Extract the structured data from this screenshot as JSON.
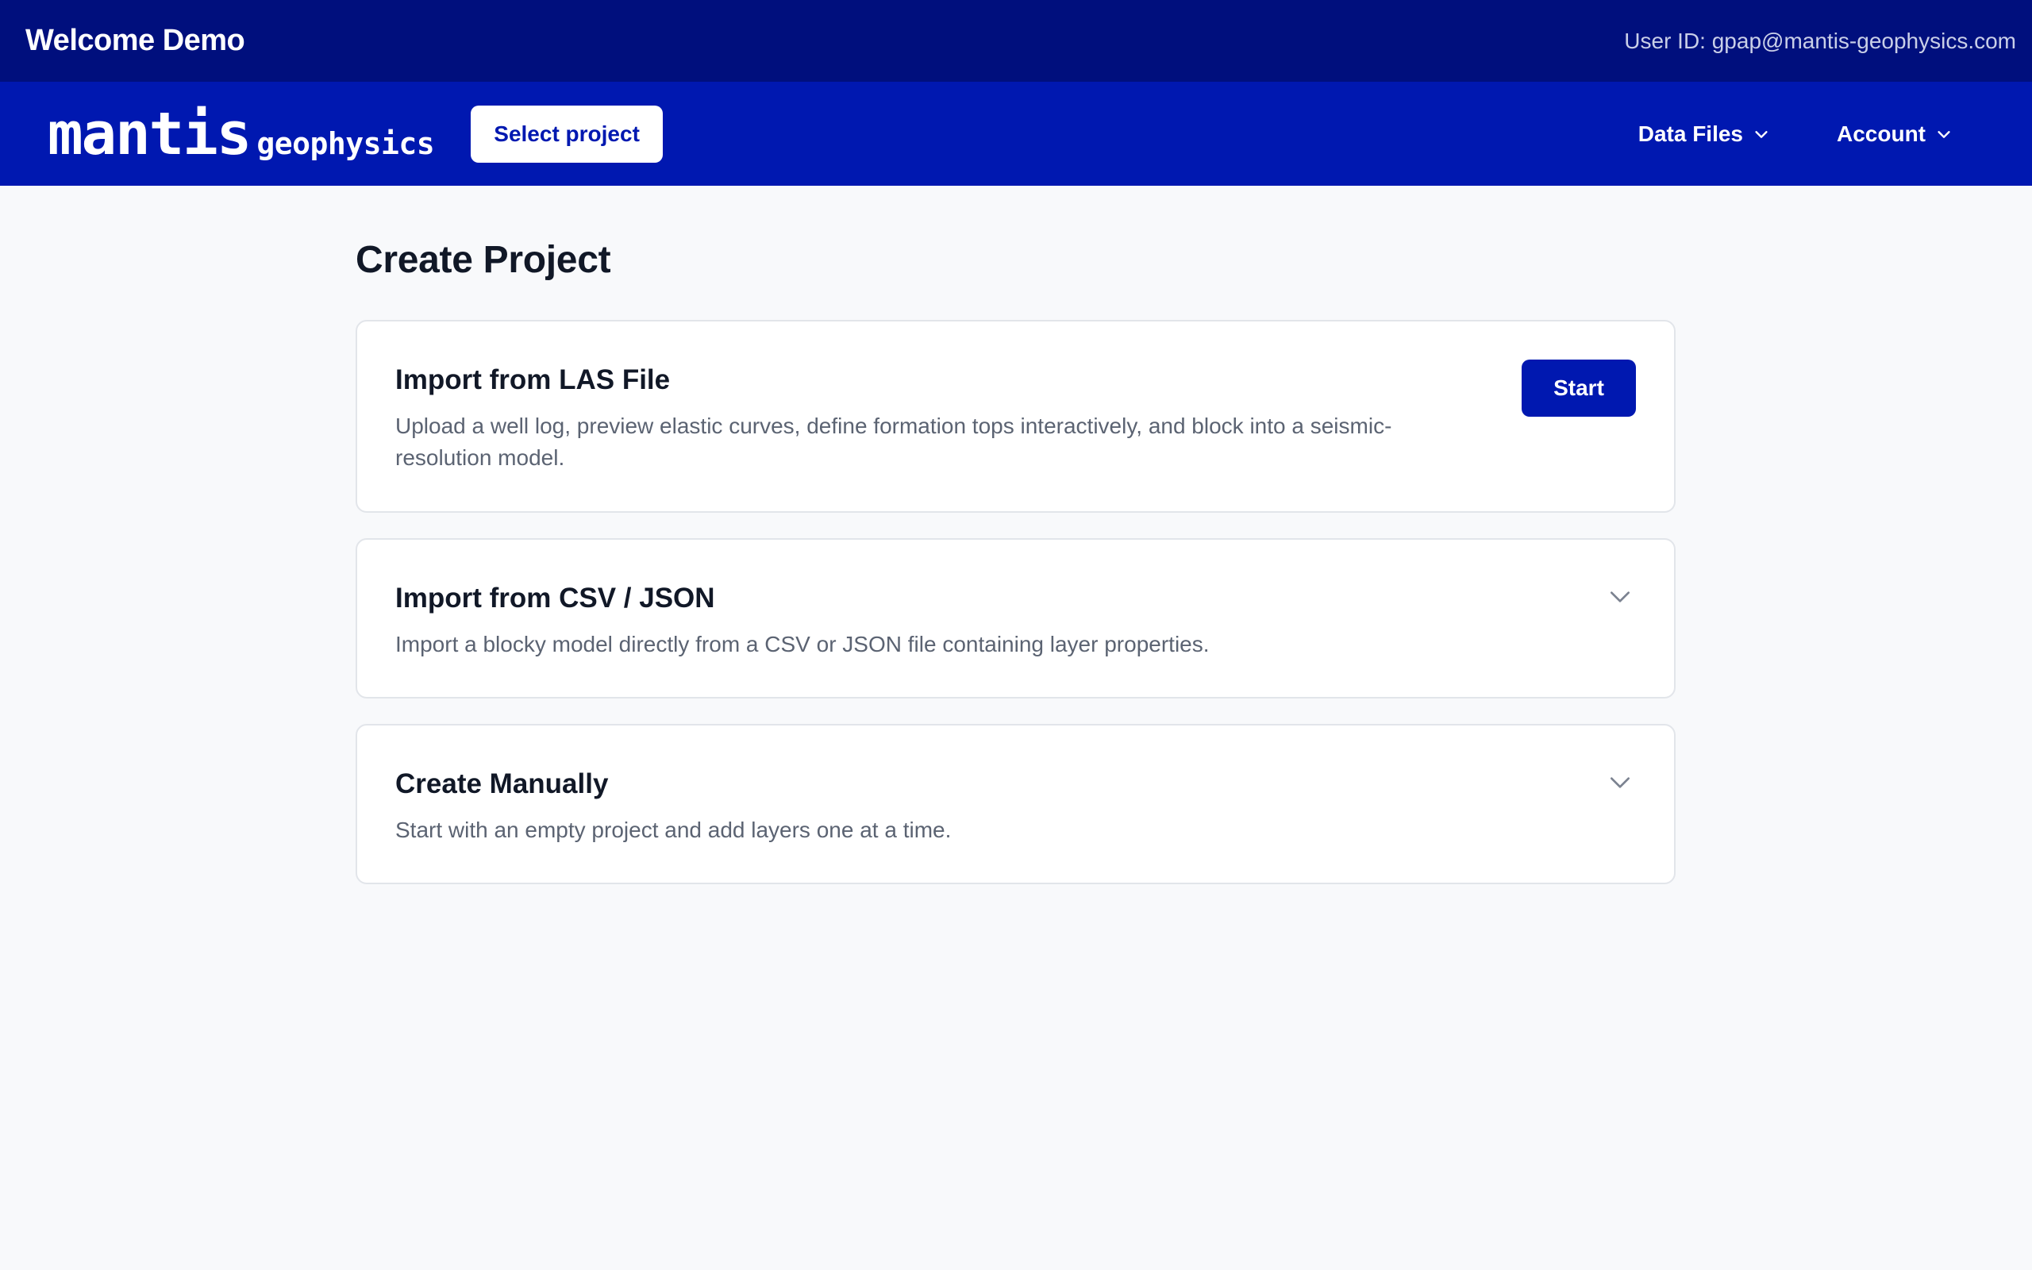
{
  "topbar": {
    "title": "Welcome Demo",
    "user_label": "User ID: gpap@mantis-geophysics.com"
  },
  "navbar": {
    "logo_main": "mantis",
    "logo_sub": "geophysics",
    "select_project_label": "Select project",
    "menus": [
      {
        "label": "Data Files",
        "icon": "chevron-down-icon"
      },
      {
        "label": "Account",
        "icon": "chevron-down-icon"
      }
    ]
  },
  "main": {
    "page_title": "Create Project",
    "cards": [
      {
        "title": "Import from LAS File",
        "description": "Upload a well log, preview elastic curves, define formation tops interactively, and block into a seismic-resolution model.",
        "action_label": "Start"
      },
      {
        "title": "Import from CSV / JSON",
        "description": "Import a blocky model directly from a CSV or JSON file containing layer properties.",
        "icon": "chevron-down-icon"
      },
      {
        "title": "Create Manually",
        "description": "Start with an empty project and add layers one at a time.",
        "icon": "chevron-down-icon"
      }
    ]
  },
  "colors": {
    "topbar_bg": "#000f7d",
    "navbar_bg": "#0018b0",
    "primary_button": "#0018b0",
    "page_bg": "#f8f9fb"
  }
}
